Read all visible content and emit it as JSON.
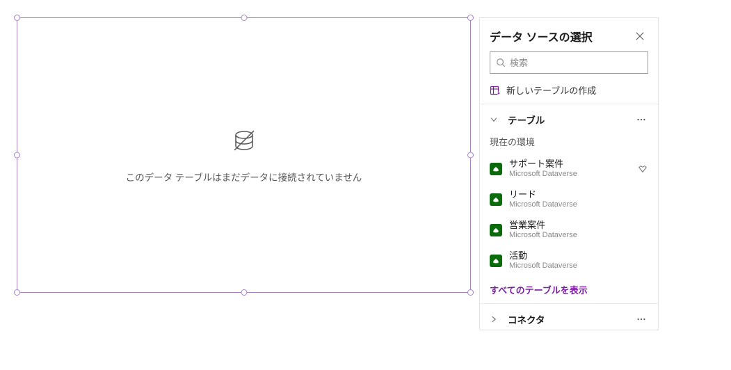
{
  "canvas": {
    "empty_text": "このデータ テーブルはまだデータに接続されていません"
  },
  "panel": {
    "title": "データ ソースの選択",
    "search_placeholder": "検索",
    "create_label": "新しいテーブルの作成",
    "groups": {
      "tables": {
        "label": "テーブル",
        "env_label": "現在の環境",
        "items": [
          {
            "title": "サポート案件",
            "source": "Microsoft Dataverse",
            "premium": true
          },
          {
            "title": "リード",
            "source": "Microsoft Dataverse",
            "premium": false
          },
          {
            "title": "営業案件",
            "source": "Microsoft Dataverse",
            "premium": false
          },
          {
            "title": "活動",
            "source": "Microsoft Dataverse",
            "premium": false
          }
        ],
        "show_all": "すべてのテーブルを表示"
      },
      "connectors": {
        "label": "コネクタ"
      }
    }
  }
}
